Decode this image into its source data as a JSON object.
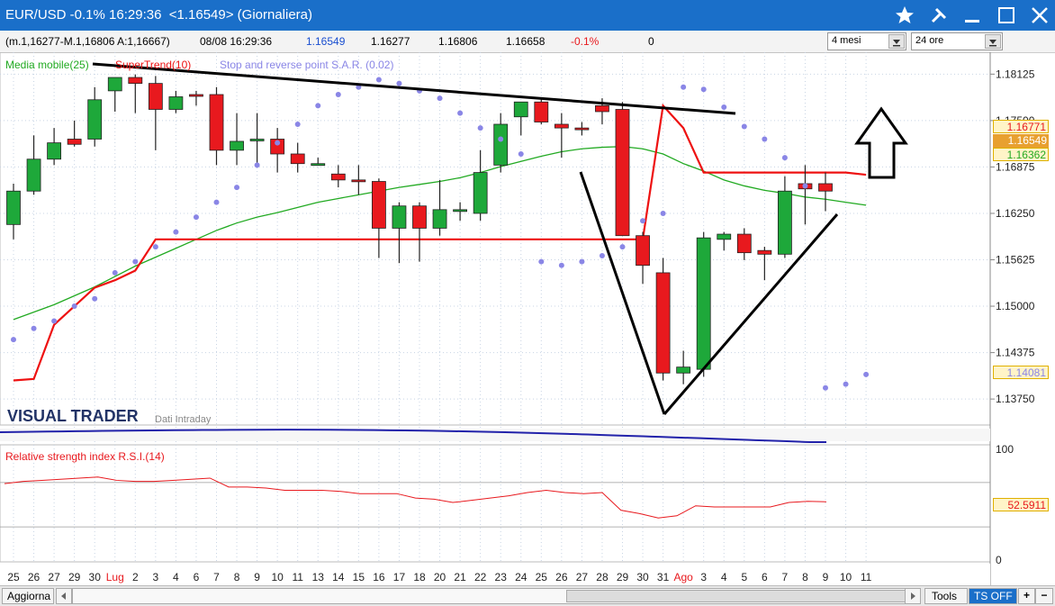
{
  "window": {
    "title": "EUR/USD -0.1% 16:29:36  <1.16549> (Giornaliera)",
    "buttons": [
      "star-icon",
      "pin-icon",
      "minimize-icon",
      "maximize-icon",
      "close-icon"
    ]
  },
  "infobar": {
    "ohlc": "(m.1,16277-M.1,16806 A:1,16667)",
    "datetime": "08/08 16:29:36",
    "last": "1.16549",
    "v1": "1.16277",
    "v2": "1.16806",
    "v3": "1.16658",
    "change": "-0.1%",
    "volume": "0",
    "period_select": "4 mesi",
    "interval_select": "24 ore"
  },
  "indicators": {
    "ma": "Media mobile(25)",
    "supertrend": "SuperTrend(10)",
    "sar": "Stop and reverse point S.A.R. (0.02)",
    "rsi": "Relative strength index R.S.I.(14)"
  },
  "branding": {
    "logo": "VISUAL TRADER",
    "sub": "Dati Intraday"
  },
  "price_tags": {
    "supertrend": "1.16771",
    "last": "1.16549",
    "ma": "1.16362",
    "sar": "1.14081",
    "rsi": "52.5911"
  },
  "colors": {
    "accent": "#1a6fc9",
    "bull": "#1ea83a",
    "bear": "#e8191e",
    "ma": "#22aa22",
    "sar": "#8a86e6",
    "supertrend": "#ee1111",
    "rsi": "#e8191e"
  },
  "bottom": {
    "aggiorna": "Aggiorna",
    "tools": "Tools",
    "tsoff": "TS OFF"
  },
  "chart_data": {
    "type": "candlestick",
    "price_axis_ticks": [
      "1.18125",
      "1.17500",
      "1.16875",
      "1.16250",
      "1.15625",
      "1.15000",
      "1.14375",
      "1.13750"
    ],
    "ylim": [
      1.134,
      1.1842
    ],
    "x_labels": [
      "25",
      "26",
      "27",
      "29",
      "30",
      "Lug",
      "2",
      "3",
      "4",
      "6",
      "7",
      "8",
      "9",
      "10",
      "11",
      "13",
      "14",
      "15",
      "16",
      "17",
      "18",
      "20",
      "21",
      "22",
      "23",
      "24",
      "25",
      "26",
      "27",
      "28",
      "29",
      "30",
      "31",
      "Ago",
      "3",
      "4",
      "5",
      "6",
      "7",
      "8",
      "9",
      "10",
      "11"
    ],
    "candles": [
      {
        "o": 1.161,
        "h": 1.1665,
        "l": 1.159,
        "c": 1.1655
      },
      {
        "o": 1.1655,
        "h": 1.173,
        "l": 1.165,
        "c": 1.1698
      },
      {
        "o": 1.1698,
        "h": 1.174,
        "l": 1.169,
        "c": 1.172
      },
      {
        "o": 1.1725,
        "h": 1.175,
        "l": 1.1715,
        "c": 1.1718
      },
      {
        "o": 1.1725,
        "h": 1.1795,
        "l": 1.1715,
        "c": 1.1778
      },
      {
        "o": 1.179,
        "h": 1.18,
        "l": 1.1762,
        "c": 1.1808
      },
      {
        "o": 1.1808,
        "h": 1.1812,
        "l": 1.176,
        "c": 1.18
      },
      {
        "o": 1.18,
        "h": 1.181,
        "l": 1.171,
        "c": 1.1765
      },
      {
        "o": 1.1765,
        "h": 1.179,
        "l": 1.176,
        "c": 1.1782
      },
      {
        "o": 1.1785,
        "h": 1.179,
        "l": 1.177,
        "c": 1.1783
      },
      {
        "o": 1.1785,
        "h": 1.1795,
        "l": 1.169,
        "c": 1.171
      },
      {
        "o": 1.171,
        "h": 1.176,
        "l": 1.169,
        "c": 1.1722
      },
      {
        "o": 1.1725,
        "h": 1.176,
        "l": 1.169,
        "c": 1.1725
      },
      {
        "o": 1.1725,
        "h": 1.174,
        "l": 1.168,
        "c": 1.1705
      },
      {
        "o": 1.1705,
        "h": 1.172,
        "l": 1.168,
        "c": 1.1692
      },
      {
        "o": 1.1692,
        "h": 1.17,
        "l": 1.1692,
        "c": 1.1692
      },
      {
        "o": 1.1678,
        "h": 1.169,
        "l": 1.166,
        "c": 1.167
      },
      {
        "o": 1.167,
        "h": 1.169,
        "l": 1.165,
        "c": 1.1668
      },
      {
        "o": 1.1668,
        "h": 1.1672,
        "l": 1.1565,
        "c": 1.1605
      },
      {
        "o": 1.1605,
        "h": 1.164,
        "l": 1.1558,
        "c": 1.1635
      },
      {
        "o": 1.1635,
        "h": 1.164,
        "l": 1.156,
        "c": 1.1605
      },
      {
        "o": 1.1605,
        "h": 1.167,
        "l": 1.1595,
        "c": 1.163
      },
      {
        "o": 1.1628,
        "h": 1.164,
        "l": 1.1615,
        "c": 1.163
      },
      {
        "o": 1.1625,
        "h": 1.171,
        "l": 1.1615,
        "c": 1.168
      },
      {
        "o": 1.169,
        "h": 1.176,
        "l": 1.168,
        "c": 1.1745
      },
      {
        "o": 1.1755,
        "h": 1.1775,
        "l": 1.173,
        "c": 1.1775
      },
      {
        "o": 1.1775,
        "h": 1.178,
        "l": 1.1745,
        "c": 1.1748
      },
      {
        "o": 1.1745,
        "h": 1.176,
        "l": 1.17,
        "c": 1.174
      },
      {
        "o": 1.174,
        "h": 1.1748,
        "l": 1.173,
        "c": 1.1738
      },
      {
        "o": 1.177,
        "h": 1.178,
        "l": 1.1745,
        "c": 1.1762
      },
      {
        "o": 1.1765,
        "h": 1.1775,
        "l": 1.1595,
        "c": 1.1595
      },
      {
        "o": 1.1595,
        "h": 1.16,
        "l": 1.153,
        "c": 1.1555
      },
      {
        "o": 1.1545,
        "h": 1.1565,
        "l": 1.14,
        "c": 1.141
      },
      {
        "o": 1.141,
        "h": 1.144,
        "l": 1.1395,
        "c": 1.1418
      },
      {
        "o": 1.1415,
        "h": 1.16,
        "l": 1.1405,
        "c": 1.1592
      },
      {
        "o": 1.159,
        "h": 1.16,
        "l": 1.1575,
        "c": 1.1597
      },
      {
        "o": 1.1597,
        "h": 1.1605,
        "l": 1.1562,
        "c": 1.1572
      },
      {
        "o": 1.1575,
        "h": 1.158,
        "l": 1.1535,
        "c": 1.157
      },
      {
        "o": 1.157,
        "h": 1.1675,
        "l": 1.1565,
        "c": 1.1655
      },
      {
        "o": 1.1665,
        "h": 1.169,
        "l": 1.161,
        "c": 1.1658
      },
      {
        "o": 1.1665,
        "h": 1.168,
        "l": 1.1628,
        "c": 1.1655
      }
    ],
    "ma": [
      1.1482,
      1.1492,
      1.1502,
      1.1514,
      1.1526,
      1.154,
      1.1554,
      1.1566,
      1.1578,
      1.159,
      1.1602,
      1.1612,
      1.162,
      1.1626,
      1.1633,
      1.164,
      1.1645,
      1.165,
      1.1655,
      1.166,
      1.1664,
      1.1668,
      1.1673,
      1.168,
      1.1688,
      1.1695,
      1.1702,
      1.1708,
      1.1712,
      1.1714,
      1.1715,
      1.1712,
      1.1705,
      1.1692,
      1.1682,
      1.167,
      1.1662,
      1.1656,
      1.1652,
      1.1647,
      1.1644,
      1.164,
      1.1636
    ],
    "supertrend": [
      1.14,
      1.1402,
      1.1475,
      1.15,
      1.1525,
      1.1535,
      1.1548,
      1.159,
      1.159,
      1.159,
      1.159,
      1.159,
      1.159,
      1.159,
      1.159,
      1.159,
      1.159,
      1.159,
      1.159,
      1.159,
      1.159,
      1.159,
      1.159,
      1.159,
      1.159,
      1.159,
      1.159,
      1.159,
      1.159,
      1.159,
      1.159,
      1.159,
      1.177,
      1.174,
      1.168,
      1.168,
      1.168,
      1.168,
      1.168,
      1.168,
      1.168,
      1.168,
      1.1677
    ],
    "sar": [
      1.1455,
      1.147,
      1.148,
      1.15,
      1.151,
      1.1545,
      1.156,
      1.158,
      1.16,
      1.162,
      1.164,
      1.166,
      1.169,
      1.172,
      1.1745,
      1.177,
      1.1785,
      1.1795,
      1.1805,
      1.18,
      1.179,
      1.178,
      1.176,
      1.174,
      1.1725,
      1.1705,
      1.156,
      1.1555,
      1.156,
      1.1568,
      1.158,
      1.1615,
      1.1625,
      1.1795,
      1.1792,
      1.1768,
      1.1742,
      1.1725,
      1.17,
      1.1662,
      1.139,
      1.1395,
      1.1408
    ],
    "rsi_ylim": [
      0,
      100
    ],
    "rsi_ticks": [
      "100",
      "0"
    ],
    "rsi": [
      69,
      71,
      72,
      73,
      74,
      75,
      72,
      71,
      71,
      72,
      73,
      74,
      66,
      66,
      65,
      63,
      63,
      63,
      62,
      60,
      60,
      60,
      56,
      55,
      52,
      54,
      56,
      58,
      61,
      63,
      61,
      60,
      61,
      45,
      42,
      38,
      40,
      49,
      48,
      48,
      48,
      48,
      52,
      53,
      52.6
    ]
  }
}
